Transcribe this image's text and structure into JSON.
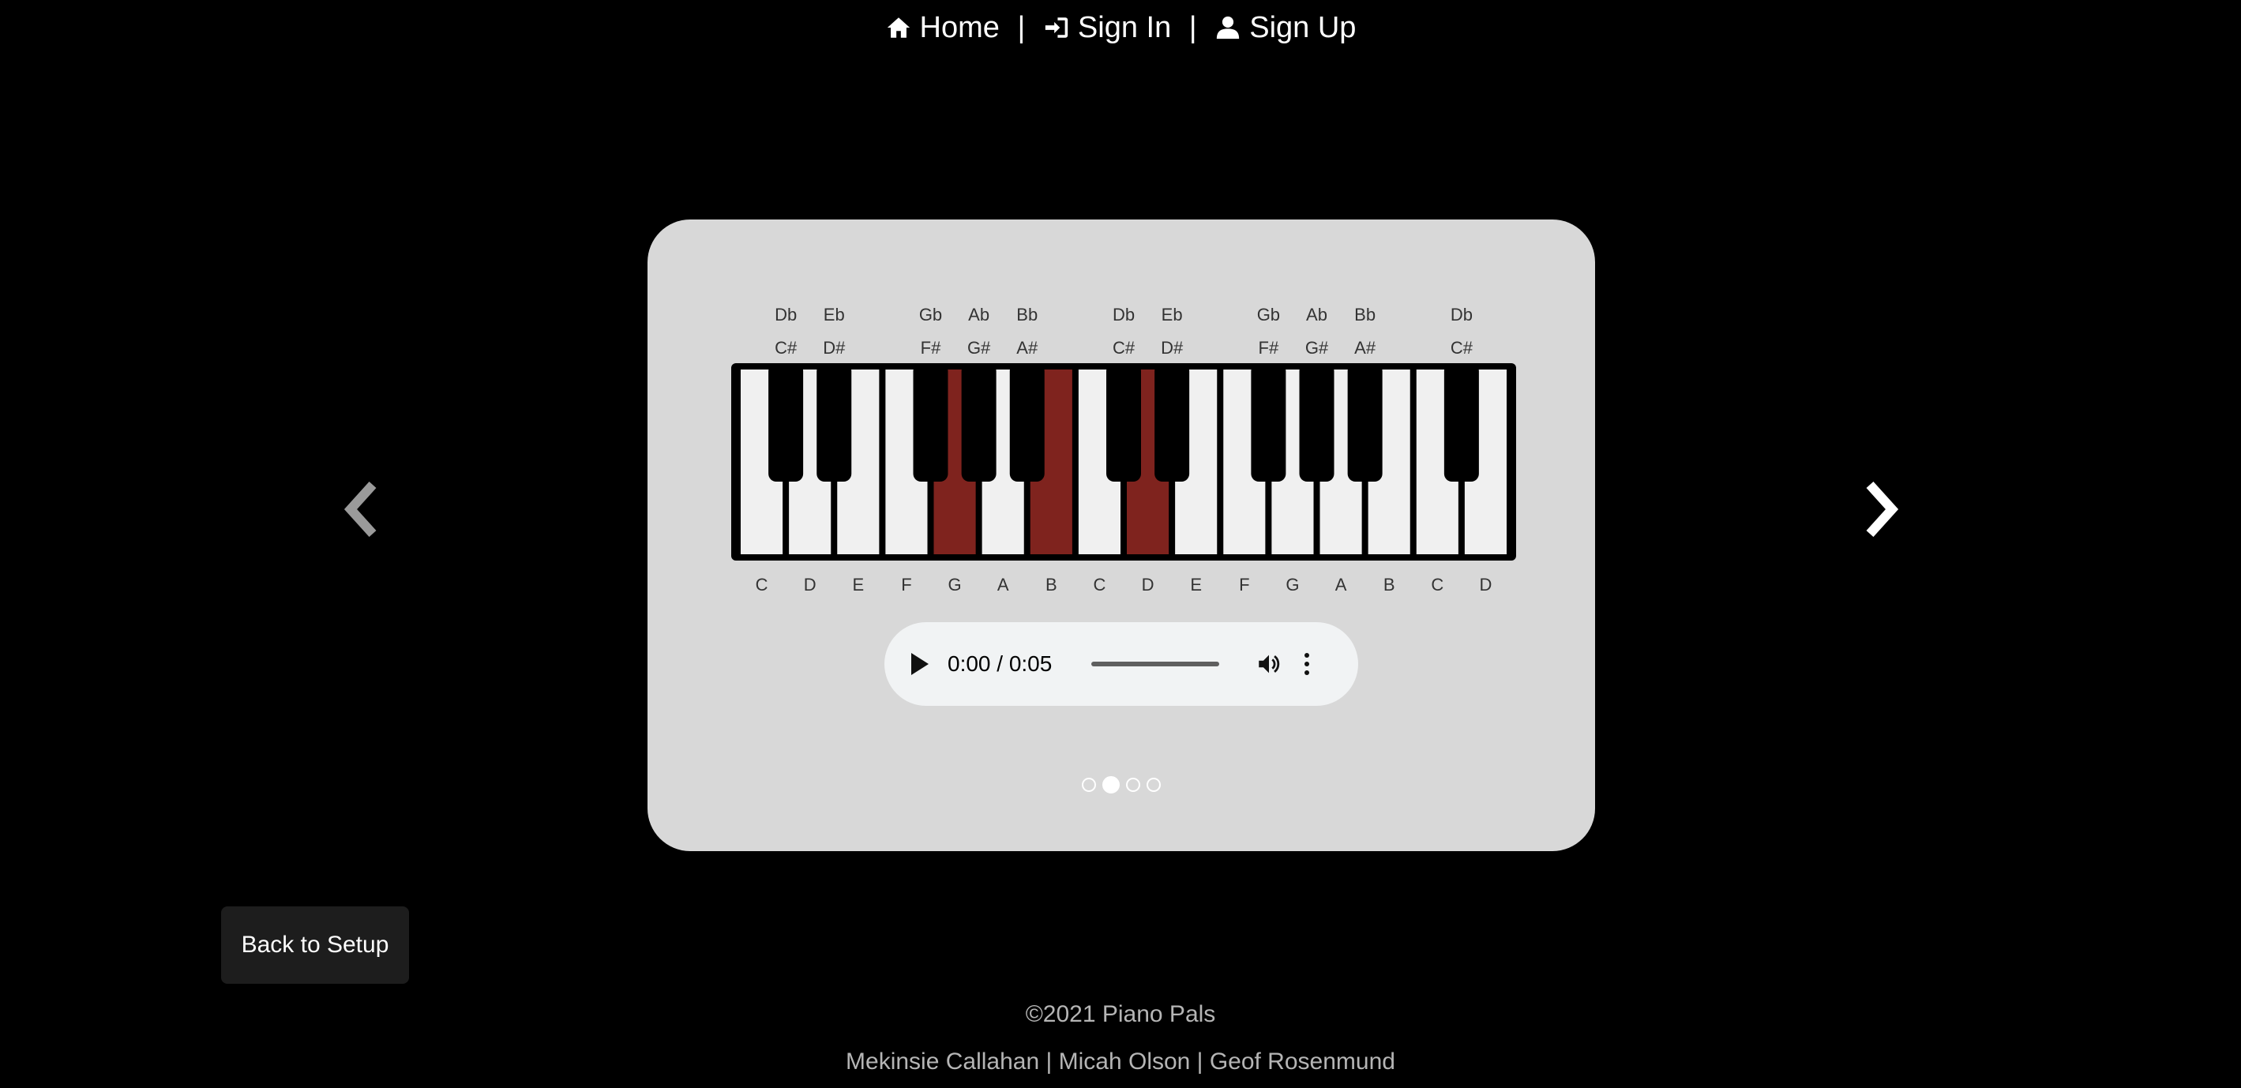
{
  "nav": {
    "home": "Home",
    "sep": "|",
    "sign_in": "Sign In",
    "sign_up": "Sign Up"
  },
  "piano": {
    "white_keys": [
      "C",
      "D",
      "E",
      "F",
      "G",
      "A",
      "B",
      "C",
      "D",
      "E",
      "F",
      "G",
      "A",
      "B",
      "C",
      "D"
    ],
    "black_keys": [
      {
        "after": 0,
        "sharp": "C#",
        "flat": "Db",
        "highlighted": false
      },
      {
        "after": 1,
        "sharp": "D#",
        "flat": "Eb",
        "highlighted": false
      },
      {
        "after": 3,
        "sharp": "F#",
        "flat": "Gb",
        "highlighted": false
      },
      {
        "after": 4,
        "sharp": "G#",
        "flat": "Ab",
        "highlighted": false
      },
      {
        "after": 5,
        "sharp": "A#",
        "flat": "Bb",
        "highlighted": false
      },
      {
        "after": 7,
        "sharp": "C#",
        "flat": "Db",
        "highlighted": false
      },
      {
        "after": 8,
        "sharp": "D#",
        "flat": "Eb",
        "highlighted": false
      },
      {
        "after": 10,
        "sharp": "F#",
        "flat": "Gb",
        "highlighted": false
      },
      {
        "after": 11,
        "sharp": "G#",
        "flat": "Ab",
        "highlighted": false
      },
      {
        "after": 12,
        "sharp": "A#",
        "flat": "Bb",
        "highlighted": false
      },
      {
        "after": 14,
        "sharp": "C#",
        "flat": "Db",
        "highlighted": false
      }
    ],
    "highlighted_white_keys": [
      4,
      6,
      8
    ],
    "highlight_color": "#7f231e"
  },
  "audio": {
    "time": "0:00 / 0:05"
  },
  "carousel": {
    "slide_count": 4,
    "active_index": 1
  },
  "back_button": "Back to Setup",
  "footer": {
    "copyright": "©2021 Piano Pals",
    "authors": "Mekinsie Callahan | Micah Olson | Geof Rosenmund"
  }
}
